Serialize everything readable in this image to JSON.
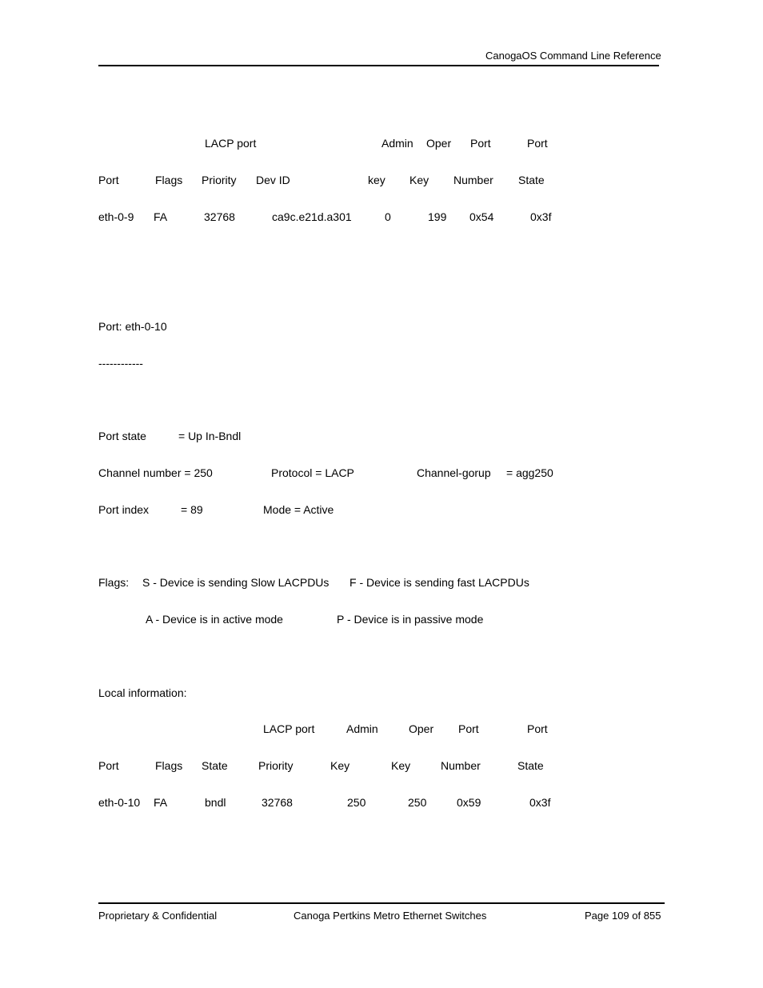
{
  "header": {
    "title": "CanogaOS Command Line Reference"
  },
  "partner_table": {
    "header_row1": [
      "LACP port",
      "Admin",
      "Oper",
      "Port",
      "Port"
    ],
    "header_row2": [
      "Port",
      "Flags",
      "Priority",
      "Dev ID",
      "key",
      "Key",
      "Number",
      "State"
    ],
    "rows": [
      [
        "eth-0-9",
        "FA",
        "32768",
        "ca9c.e21d.a301",
        "0",
        "199",
        "0x54",
        "0x3f"
      ]
    ]
  },
  "port_section": {
    "port_line": "Port: eth-0-10",
    "separator": "------------",
    "port_state_label": "Port state",
    "port_state_value": "= Up In-Bndl",
    "channel_number": "Channel number = 250",
    "protocol": "Protocol = LACP",
    "channel_group_label": "Channel-gorup",
    "channel_group_value": "= agg250",
    "port_index_label": "Port index",
    "port_index_value": "= 89",
    "mode": "Mode = Active"
  },
  "flags_legend": {
    "label": "Flags:",
    "s": "S - Device is sending Slow LACPDUs",
    "f": "F - Device is sending fast LACPDUs",
    "a": "A - Device is in active mode",
    "p": "P - Device is in passive mode"
  },
  "local_info": {
    "title": "Local information:",
    "header_row1": [
      "LACP port",
      "Admin",
      "Oper",
      "Port",
      "Port"
    ],
    "header_row2": [
      "Port",
      "Flags",
      "State",
      "Priority",
      "Key",
      "Key",
      "Number",
      "State"
    ],
    "rows": [
      [
        "eth-0-10",
        "FA",
        "bndl",
        "32768",
        "250",
        "250",
        "0x59",
        "0x3f"
      ]
    ]
  },
  "footer": {
    "left": "Proprietary & Confidential",
    "center": "Canoga Pertkins Metro Ethernet Switches",
    "right": "Page 109 of 855"
  }
}
